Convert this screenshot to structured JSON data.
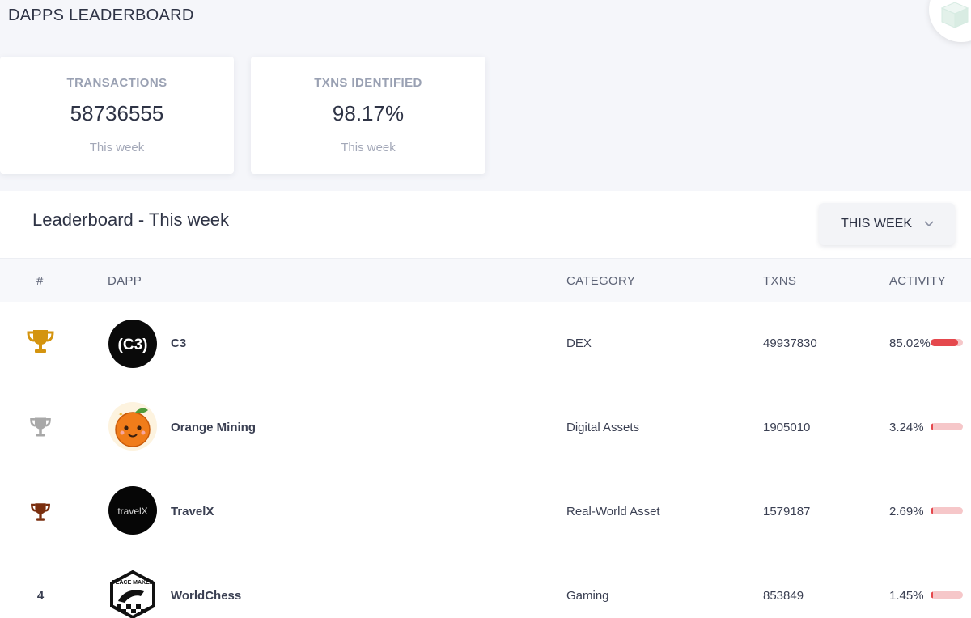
{
  "header": {
    "title": "DAPPS LEADERBOARD"
  },
  "stats": [
    {
      "label": "TRANSACTIONS",
      "value": "58736555",
      "sub": "This week"
    },
    {
      "label": "TXNS IDENTIFIED",
      "value": "98.17%",
      "sub": "This week"
    }
  ],
  "leaderboard": {
    "title": "Leaderboard - This week",
    "period_label": "THIS WEEK",
    "columns": {
      "rank": "#",
      "dapp": "DAPP",
      "category": "CATEGORY",
      "txns": "TXNS",
      "activity": "ACTIVITY"
    },
    "rows": [
      {
        "rank": "1",
        "trophy": "gold-trophy-icon",
        "name": "C3",
        "logo_text": "(C3)",
        "category": "DEX",
        "txns": "49937830",
        "activity": "85.02%",
        "activity_fraction": 0.8502
      },
      {
        "rank": "2",
        "trophy": "silver-trophy-icon",
        "name": "Orange Mining",
        "logo_text": "",
        "category": "Digital Assets",
        "txns": "1905010",
        "activity": "3.24%",
        "activity_fraction": 0.0324
      },
      {
        "rank": "3",
        "trophy": "bronze-trophy-icon",
        "name": "TravelX",
        "logo_text": "travelX",
        "category": "Real-World Asset",
        "txns": "1579187",
        "activity": "2.69%",
        "activity_fraction": 0.0269
      },
      {
        "rank": "4",
        "trophy": "",
        "name": "WorldChess",
        "logo_text": "PEACE MAKER",
        "category": "Gaming",
        "txns": "853849",
        "activity": "1.45%",
        "activity_fraction": 0.0145
      }
    ]
  },
  "colors": {
    "gold": "#d4940f",
    "silver": "#a8a8a8",
    "bronze": "#7a2e0e",
    "bar_fill": "#e5484d",
    "bar_track": "#f6c7c9"
  }
}
